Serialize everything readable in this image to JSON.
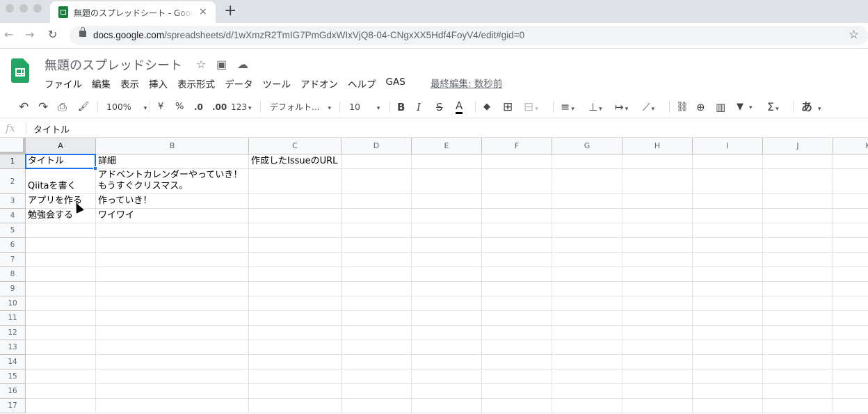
{
  "browser": {
    "tab_title": "無題のスプレッドシート - Google スプレッドシート",
    "tab_close": "×",
    "new_tab": "+",
    "back": "←",
    "forward": "→",
    "reload": "↻",
    "url_host": "docs.google.com",
    "url_path": "/spreadsheets/d/1wXmzR2TmIG7PmGdxWIxVjQ8-04-CNgxXX5Hdf4FoyV4/edit#gid=0",
    "bookmark": "☆"
  },
  "sheets": {
    "title": "無題のスプレッドシート",
    "star": "☆",
    "move": "▣",
    "cloud": "☁",
    "menu": [
      "ファイル",
      "編集",
      "表示",
      "挿入",
      "表示形式",
      "データ",
      "ツール",
      "アドオン",
      "ヘルプ",
      "GAS"
    ],
    "last_edit": "最終編集: 数秒前"
  },
  "toolbar": {
    "undo": "↶",
    "redo": "↷",
    "print": "⎙",
    "paint_format": "🖌",
    "zoom": "100%",
    "currency": "¥",
    "percent": "%",
    "decrease_decimal": ".0",
    "increase_decimal": ".00",
    "more_formats": "123",
    "font": "デフォルト...",
    "font_size": "10",
    "bold": "B",
    "italic": "I",
    "strikethrough": "S",
    "text_color": "A",
    "fill": "◆",
    "borders": "⊞",
    "merge": "⊟",
    "align": "≡",
    "valign": "⊥",
    "wrap": "↦",
    "rotate": "⟋",
    "link": "⛓",
    "comment": "⊕",
    "chart": "▥",
    "filter": "▼",
    "functions": "Σ",
    "input_tools": "あ",
    "caret": "▾"
  },
  "formula_bar": {
    "fx": "fx",
    "value": "タイトル"
  },
  "grid": {
    "columns": [
      "A",
      "B",
      "C",
      "D",
      "E",
      "F",
      "G",
      "H",
      "I",
      "J",
      "K"
    ],
    "rows": [
      "1",
      "2",
      "3",
      "4",
      "5",
      "6",
      "7",
      "8",
      "9",
      "10",
      "11",
      "12",
      "13",
      "14",
      "15",
      "16",
      "17"
    ],
    "cells": {
      "A1": "タイトル",
      "B1": "詳細",
      "C1": "作成したIssueのURL",
      "A2": "Qiitaを書く",
      "B2": "アドベントカレンダーやっていき！\nもうすぐクリスマス。",
      "A3": "アプリを作る",
      "B3": "作っていき！",
      "A4": "勉強会する",
      "B4": "ワイワイ"
    },
    "selected_cell": "A1",
    "selection_color": "#1a73e8"
  }
}
